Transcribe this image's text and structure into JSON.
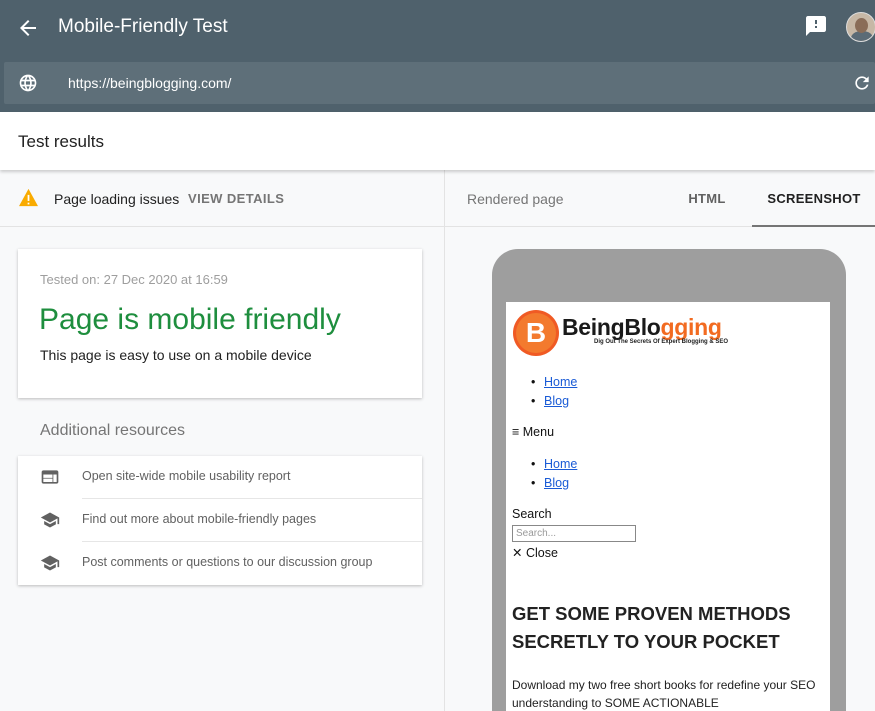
{
  "app": {
    "title": "Mobile-Friendly Test",
    "url": "https://beingblogging.com/"
  },
  "results": {
    "title": "Test results",
    "issues_label": "Page loading issues",
    "view_details": "VIEW DETAILS",
    "tested_on": "Tested on: 27 Dec 2020 at 16:59",
    "verdict": "Page is mobile friendly",
    "verdict_sub": "This page is easy to use on a mobile device",
    "verdict_color": "#1e8e3e"
  },
  "resources": {
    "heading": "Additional resources",
    "items": [
      {
        "label": "Open site-wide mobile usability report",
        "icon": "web-report-icon"
      },
      {
        "label": "Find out more about mobile-friendly pages",
        "icon": "school-icon"
      },
      {
        "label": "Post comments or questions to our discussion group",
        "icon": "school-icon"
      }
    ]
  },
  "rendered": {
    "label": "Rendered page",
    "tabs": [
      {
        "label": "HTML",
        "active": false
      },
      {
        "label": "SCREENSHOT",
        "active": true
      }
    ]
  },
  "phone_screen": {
    "logo_letter": "B",
    "logo_dark": "BeingBlo",
    "logo_orange": "gging",
    "tagline": "Dig Out The Secrets Of Expert Blogging & SEO",
    "nav1": [
      "Home",
      "Blog"
    ],
    "menu_label": "≡ Menu",
    "nav2": [
      "Home",
      "Blog"
    ],
    "search_label": "Search",
    "search_placeholder": "Search...",
    "close_label": "✕ Close",
    "headline": "GET SOME PROVEN METHODS SECRETLY TO YOUR POCKET",
    "body": "Download my two free short books for redefine your SEO understanding to SOME ACTIONABLE"
  }
}
